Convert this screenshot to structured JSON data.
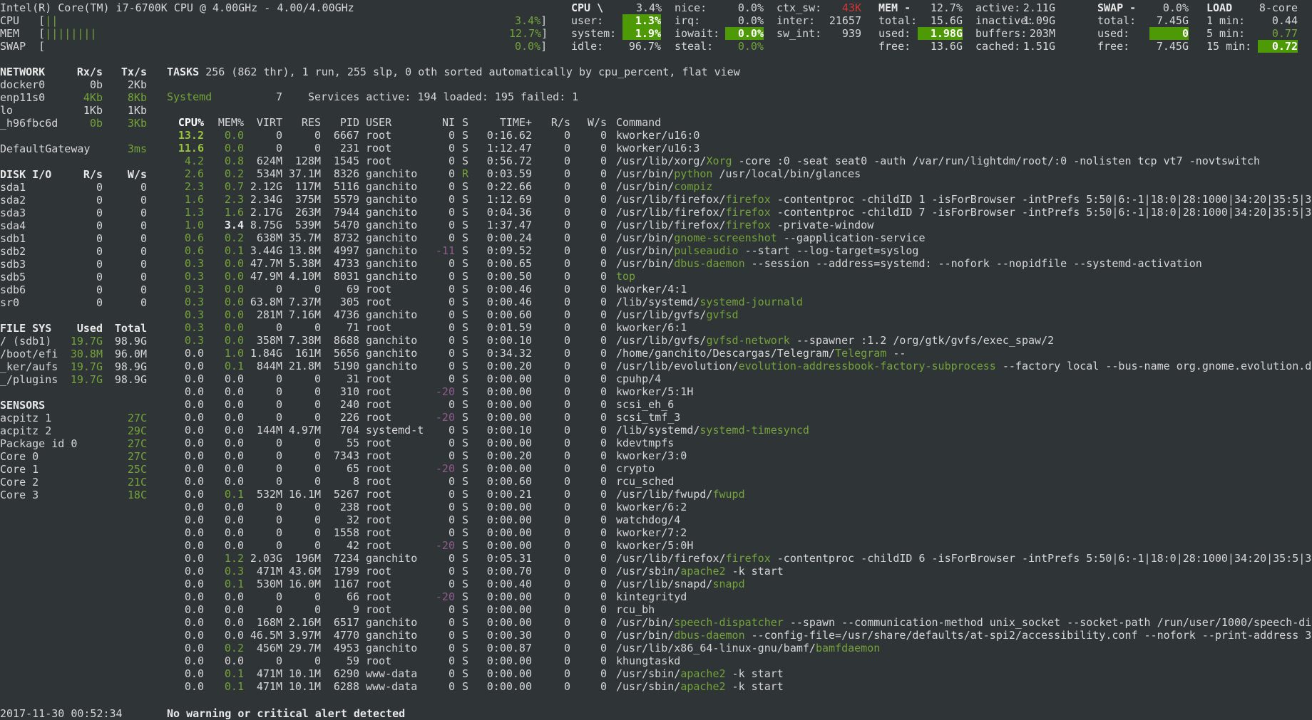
{
  "header": {
    "cpu_model": "Intel(R) Core(TM) i7-6700K CPU @ 4.00GHz - 4.00/4.00GHz",
    "bars": [
      {
        "label": "CPU ",
        "fill": "||",
        "pct": "3.4%"
      },
      {
        "label": "MEM ",
        "fill": "||||||||",
        "pct": "12.7%"
      },
      {
        "label": "SWAP",
        "fill": "",
        "pct": "0.0%"
      }
    ],
    "cpu": {
      "title": "CPU \\",
      "total": "3.4%",
      "user": "1.3%",
      "system": "1.9%",
      "idle": "96.7%",
      "nice": "0.0%",
      "irq": "0.0%",
      "iowait": "0.0%",
      "steal": "0.0%",
      "ctx_sw": "43K",
      "inter": "21657",
      "sw_int": "939"
    },
    "mem": {
      "title": "MEM -",
      "total_pct": "12.7%",
      "total": "15.6G",
      "used": "1.98G",
      "free": "13.6G",
      "active": "2.11G",
      "inactive": "1.09G",
      "buffers": "203M",
      "cached": "1.51G"
    },
    "swap": {
      "title": "SWAP -",
      "pct": "0.0%",
      "total": "7.45G",
      "used": "0",
      "free": "7.45G"
    },
    "load": {
      "title": "LOAD",
      "cores": "8-core",
      "m1": "0.44",
      "m5": "0.77",
      "m15": "0.72"
    }
  },
  "network": {
    "title": "NETWORK",
    "rx": "Rx/s",
    "tx": "Tx/s",
    "rows": [
      [
        "docker0",
        "0b",
        "2Kb"
      ],
      [
        "enp11s0",
        "4Kb",
        "8Kb"
      ],
      [
        "lo",
        "1Kb",
        "1Kb"
      ],
      [
        "_h96fbc6d",
        "0b",
        "3Kb"
      ]
    ],
    "gateway": "DefaultGateway",
    "gateway_val": "3ms"
  },
  "disk": {
    "title": "DISK I/O",
    "r": "R/s",
    "w": "W/s",
    "rows": [
      [
        "sda1",
        "0",
        "0"
      ],
      [
        "sda2",
        "0",
        "0"
      ],
      [
        "sda3",
        "0",
        "0"
      ],
      [
        "sda4",
        "0",
        "0"
      ],
      [
        "sdb1",
        "0",
        "0"
      ],
      [
        "sdb2",
        "0",
        "0"
      ],
      [
        "sdb3",
        "0",
        "0"
      ],
      [
        "sdb5",
        "0",
        "0"
      ],
      [
        "sdb6",
        "0",
        "0"
      ],
      [
        "sr0",
        "0",
        "0"
      ]
    ]
  },
  "fs": {
    "title": "FILE SYS",
    "used": "Used",
    "total": "Total",
    "rows": [
      [
        "/ (sdb1)",
        "19.7G",
        "98.9G"
      ],
      [
        "/boot/efi",
        "30.8M",
        "96.0M"
      ],
      [
        "_ker/aufs",
        "19.7G",
        "98.9G"
      ],
      [
        "_/plugins",
        "19.7G",
        "98.9G"
      ]
    ]
  },
  "sensors": {
    "title": "SENSORS",
    "rows": [
      [
        "acpitz 1",
        "27C"
      ],
      [
        "acpitz 2",
        "29C"
      ],
      [
        "Package id 0",
        "27C"
      ],
      [
        "Core 0",
        "27C"
      ],
      [
        "Core 1",
        "25C"
      ],
      [
        "Core 2",
        "21C"
      ],
      [
        "Core 3",
        "18C"
      ]
    ]
  },
  "tasks": {
    "label": "TASKS",
    "summary": "256 (862 thr), 1 run, 255 slp, 0 oth sorted automatically by cpu_percent, flat view",
    "systemd": "Systemd",
    "systemd_n": "7",
    "services": "Services active: 194 loaded: 195 failed: 1"
  },
  "columns": [
    "CPU%",
    "MEM%",
    "VIRT",
    "RES",
    "PID",
    "USER",
    "NI",
    "S",
    "TIME+",
    "R/s",
    "W/s",
    "Command"
  ],
  "processes": [
    [
      "13.2",
      "0.0",
      "0",
      "0",
      "6667",
      "root",
      "0",
      "S",
      "0:16.62",
      "0",
      "0",
      "kworker/u16:0"
    ],
    [
      "11.6",
      "0.0",
      "0",
      "0",
      "231",
      "root",
      "0",
      "S",
      "1:12.47",
      "0",
      "0",
      "kworker/u16:3"
    ],
    [
      "4.2",
      "0.8",
      "624M",
      "128M",
      "1545",
      "root",
      "0",
      "S",
      "0:56.72",
      "0",
      "0",
      "/usr/lib/xorg/",
      "Xorg",
      " -core :0 -seat seat0 -auth /var/run/lightdm/root/:0 -nolisten tcp vt7 -novtswitch"
    ],
    [
      "2.6",
      "0.2",
      "534M",
      "37.1M",
      "8326",
      "ganchito",
      "0",
      "R",
      "0:03.59",
      "0",
      "0",
      "/usr/bin/",
      "python",
      " /usr/local/bin/glances"
    ],
    [
      "2.3",
      "0.7",
      "2.12G",
      "117M",
      "5116",
      "ganchito",
      "0",
      "S",
      "0:22.66",
      "0",
      "0",
      "/usr/bin/",
      "compiz",
      ""
    ],
    [
      "1.6",
      "2.3",
      "2.34G",
      "375M",
      "5579",
      "ganchito",
      "0",
      "S",
      "1:12.69",
      "0",
      "0",
      "/usr/lib/firefox/",
      "firefox",
      " -contentproc -childID 1 -isForBrowser -intPrefs 5:50|6:-1|18:0|28:1000|34:20|35:5|3"
    ],
    [
      "1.3",
      "1.6",
      "2.17G",
      "263M",
      "7944",
      "ganchito",
      "0",
      "S",
      "0:04.36",
      "0",
      "0",
      "/usr/lib/firefox/",
      "firefox",
      " -contentproc -childID 7 -isForBrowser -intPrefs 5:50|6:-1|18:0|28:1000|34:20|35:5|3"
    ],
    [
      "1.0",
      "3.4",
      "8.75G",
      "539M",
      "5470",
      "ganchito",
      "0",
      "S",
      "1:37.47",
      "0",
      "0",
      "/usr/lib/firefox/",
      "firefox",
      " -private-window"
    ],
    [
      "0.6",
      "0.2",
      "638M",
      "35.7M",
      "8732",
      "ganchito",
      "0",
      "S",
      "0:00.24",
      "0",
      "0",
      "/usr/bin/",
      "gnome-screenshot",
      " --gapplication-service"
    ],
    [
      "0.6",
      "0.1",
      "3.44G",
      "13.8M",
      "4997",
      "ganchito",
      "-11",
      "S",
      "0:09.52",
      "0",
      "0",
      "/usr/bin/",
      "pulseaudio",
      " --start --log-target=syslog"
    ],
    [
      "0.3",
      "0.0",
      "47.7M",
      "5.38M",
      "4733",
      "ganchito",
      "0",
      "S",
      "0:00.65",
      "0",
      "0",
      "/usr/bin/",
      "dbus-daemon",
      " --session --address=systemd: --nofork --nopidfile --systemd-activation"
    ],
    [
      "0.3",
      "0.0",
      "47.9M",
      "4.10M",
      "8031",
      "ganchito",
      "0",
      "S",
      "0:00.50",
      "0",
      "0",
      "",
      "top",
      ""
    ],
    [
      "0.3",
      "0.0",
      "0",
      "0",
      "69",
      "root",
      "0",
      "S",
      "0:00.46",
      "0",
      "0",
      "kworker/4:1"
    ],
    [
      "0.3",
      "0.0",
      "63.8M",
      "7.37M",
      "305",
      "root",
      "0",
      "S",
      "0:00.46",
      "0",
      "0",
      "/lib/systemd/",
      "systemd-journald",
      ""
    ],
    [
      "0.3",
      "0.0",
      "281M",
      "7.16M",
      "4736",
      "ganchito",
      "0",
      "S",
      "0:00.60",
      "0",
      "0",
      "/usr/lib/gvfs/",
      "gvfsd",
      ""
    ],
    [
      "0.3",
      "0.0",
      "0",
      "0",
      "71",
      "root",
      "0",
      "S",
      "0:01.59",
      "0",
      "0",
      "kworker/6:1"
    ],
    [
      "0.3",
      "0.0",
      "358M",
      "7.38M",
      "8688",
      "ganchito",
      "0",
      "S",
      "0:00.10",
      "0",
      "0",
      "/usr/lib/gvfs/",
      "gvfsd-network",
      " --spawner :1.2 /org/gtk/gvfs/exec_spaw/2"
    ],
    [
      "0.0",
      "1.0",
      "1.84G",
      "161M",
      "5656",
      "ganchito",
      "0",
      "S",
      "0:34.32",
      "0",
      "0",
      "/home/ganchito/Descargas/Telegram/",
      "Telegram",
      " --"
    ],
    [
      "0.0",
      "0.1",
      "844M",
      "21.8M",
      "5190",
      "ganchito",
      "0",
      "S",
      "0:00.20",
      "0",
      "0",
      "/usr/lib/evolution/",
      "evolution-addressbook-factory-subprocess",
      " --factory local --bus-name org.gnome.evolution.d"
    ],
    [
      "0.0",
      "0.0",
      "0",
      "0",
      "31",
      "root",
      "0",
      "S",
      "0:00.00",
      "0",
      "0",
      "cpuhp/4"
    ],
    [
      "0.0",
      "0.0",
      "0",
      "0",
      "310",
      "root",
      "-20",
      "S",
      "0:00.00",
      "0",
      "0",
      "kworker/5:1H"
    ],
    [
      "0.0",
      "0.0",
      "0",
      "0",
      "240",
      "root",
      "0",
      "S",
      "0:00.00",
      "0",
      "0",
      "scsi_eh_6"
    ],
    [
      "0.0",
      "0.0",
      "0",
      "0",
      "226",
      "root",
      "-20",
      "S",
      "0:00.00",
      "0",
      "0",
      "scsi_tmf_3"
    ],
    [
      "0.0",
      "0.0",
      "144M",
      "4.97M",
      "704",
      "systemd-t",
      "0",
      "S",
      "0:00.10",
      "0",
      "0",
      "/lib/systemd/",
      "systemd-timesyncd",
      ""
    ],
    [
      "0.0",
      "0.0",
      "0",
      "0",
      "55",
      "root",
      "0",
      "S",
      "0:00.00",
      "0",
      "0",
      "kdevtmpfs"
    ],
    [
      "0.0",
      "0.0",
      "0",
      "0",
      "7343",
      "root",
      "0",
      "S",
      "0:00.20",
      "0",
      "0",
      "kworker/3:0"
    ],
    [
      "0.0",
      "0.0",
      "0",
      "0",
      "65",
      "root",
      "-20",
      "S",
      "0:00.00",
      "0",
      "0",
      "crypto"
    ],
    [
      "0.0",
      "0.0",
      "0",
      "0",
      "8",
      "root",
      "0",
      "S",
      "0:00.60",
      "0",
      "0",
      "rcu_sched"
    ],
    [
      "0.0",
      "0.1",
      "532M",
      "16.1M",
      "5267",
      "root",
      "0",
      "S",
      "0:00.21",
      "0",
      "0",
      "/usr/lib/fwupd/",
      "fwupd",
      ""
    ],
    [
      "0.0",
      "0.0",
      "0",
      "0",
      "238",
      "root",
      "0",
      "S",
      "0:00.00",
      "0",
      "0",
      "kworker/6:2"
    ],
    [
      "0.0",
      "0.0",
      "0",
      "0",
      "32",
      "root",
      "0",
      "S",
      "0:00.00",
      "0",
      "0",
      "watchdog/4"
    ],
    [
      "0.0",
      "0.0",
      "0",
      "0",
      "1558",
      "root",
      "0",
      "S",
      "0:00.00",
      "0",
      "0",
      "kworker/7:2"
    ],
    [
      "0.0",
      "0.0",
      "0",
      "0",
      "42",
      "root",
      "-20",
      "S",
      "0:00.00",
      "0",
      "0",
      "kworker/5:0H"
    ],
    [
      "0.0",
      "1.2",
      "2.03G",
      "196M",
      "7234",
      "ganchito",
      "0",
      "S",
      "0:05.31",
      "0",
      "0",
      "/usr/lib/firefox/",
      "firefox",
      " -contentproc -childID 6 -isForBrowser -intPrefs 5:50|6:-1|18:0|28:1000|34:20|35:5|3"
    ],
    [
      "0.0",
      "0.3",
      "471M",
      "43.6M",
      "1799",
      "root",
      "0",
      "S",
      "0:00.70",
      "0",
      "0",
      "/usr/sbin/",
      "apache2",
      " -k start"
    ],
    [
      "0.0",
      "0.1",
      "530M",
      "16.0M",
      "1167",
      "root",
      "0",
      "S",
      "0:00.40",
      "0",
      "0",
      "/usr/lib/snapd/",
      "snapd",
      ""
    ],
    [
      "0.0",
      "0.0",
      "0",
      "0",
      "66",
      "root",
      "-20",
      "S",
      "0:00.00",
      "0",
      "0",
      "kintegrityd"
    ],
    [
      "0.0",
      "0.0",
      "0",
      "0",
      "9",
      "root",
      "0",
      "S",
      "0:00.00",
      "0",
      "0",
      "rcu_bh"
    ],
    [
      "0.0",
      "0.0",
      "168M",
      "2.16M",
      "6517",
      "ganchito",
      "0",
      "S",
      "0:00.00",
      "0",
      "0",
      "/usr/bin/",
      "speech-dispatcher",
      " --spawn --communication-method unix_socket --socket-path /run/user/1000/speech-di"
    ],
    [
      "0.0",
      "0.0",
      "46.5M",
      "3.97M",
      "4770",
      "ganchito",
      "0",
      "S",
      "0:00.30",
      "0",
      "0",
      "/usr/bin/",
      "dbus-daemon",
      " --config-file=/usr/share/defaults/at-spi2/accessibility.conf --nofork --print-address 3"
    ],
    [
      "0.0",
      "0.2",
      "456M",
      "29.7M",
      "4953",
      "ganchito",
      "0",
      "S",
      "0:00.87",
      "0",
      "0",
      "/usr/lib/x86_64-linux-gnu/bamf/",
      "bamfdaemon",
      ""
    ],
    [
      "0.0",
      "0.0",
      "0",
      "0",
      "59",
      "root",
      "0",
      "S",
      "0:00.00",
      "0",
      "0",
      "khungtaskd"
    ],
    [
      "0.0",
      "0.1",
      "471M",
      "10.1M",
      "6290",
      "www-data",
      "0",
      "S",
      "0:00.00",
      "0",
      "0",
      "/usr/sbin/",
      "apache2",
      " -k start"
    ],
    [
      "0.0",
      "0.1",
      "471M",
      "10.1M",
      "6288",
      "www-data",
      "0",
      "S",
      "0:00.00",
      "0",
      "0",
      "/usr/sbin/",
      "apache2",
      " -k start"
    ]
  ],
  "footer": {
    "datetime": "2017-11-30 00:52:34",
    "alert": "No warning or critical alert detected"
  }
}
